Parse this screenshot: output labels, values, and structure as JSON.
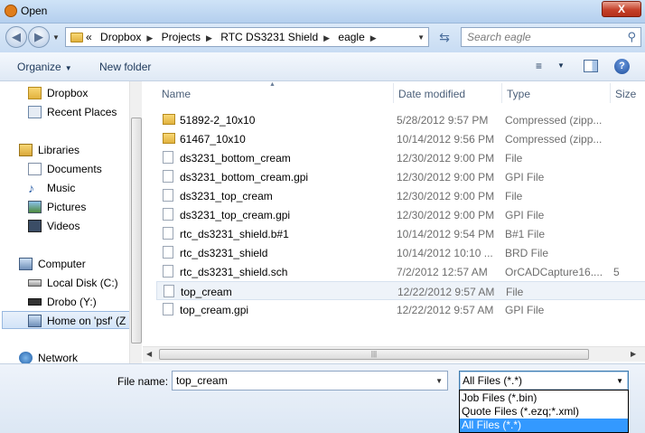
{
  "window": {
    "title": "Open",
    "close_label": "X"
  },
  "address": {
    "crumbs": [
      "«",
      "Dropbox",
      "Projects",
      "RTC DS3231 Shield",
      "eagle"
    ],
    "search_placeholder": "Search eagle"
  },
  "toolbar": {
    "organize": "Organize",
    "new_folder": "New folder"
  },
  "nav": {
    "items": [
      {
        "label": "Dropbox",
        "icon": "folder-icon"
      },
      {
        "label": "Recent Places",
        "icon": "recent-places-icon"
      },
      {
        "label": "Libraries",
        "icon": "libraries-icon"
      },
      {
        "label": "Documents",
        "icon": "documents-icon"
      },
      {
        "label": "Music",
        "icon": "music-icon"
      },
      {
        "label": "Pictures",
        "icon": "pictures-icon"
      },
      {
        "label": "Videos",
        "icon": "videos-icon"
      },
      {
        "label": "Computer",
        "icon": "computer-icon"
      },
      {
        "label": "Local Disk (C:)",
        "icon": "disk-icon"
      },
      {
        "label": "Drobo (Y:)",
        "icon": "drive-icon"
      },
      {
        "label": "Home on 'psf' (Z",
        "icon": "network-drive-icon"
      },
      {
        "label": "Network",
        "icon": "network-icon"
      }
    ]
  },
  "columns": {
    "name": "Name",
    "date": "Date modified",
    "type": "Type",
    "size": "Size"
  },
  "files": [
    {
      "name": "51892-2_10x10",
      "date": "5/28/2012 9:57 PM",
      "type": "Compressed (zipp...",
      "size": "",
      "icon": "zip-folder-icon"
    },
    {
      "name": "61467_10x10",
      "date": "10/14/2012 9:56 PM",
      "type": "Compressed (zipp...",
      "size": "",
      "icon": "zip-folder-icon"
    },
    {
      "name": "ds3231_bottom_cream",
      "date": "12/30/2012 9:00 PM",
      "type": "File",
      "size": "",
      "icon": "file-icon"
    },
    {
      "name": "ds3231_bottom_cream.gpi",
      "date": "12/30/2012 9:00 PM",
      "type": "GPI File",
      "size": "",
      "icon": "file-icon"
    },
    {
      "name": "ds3231_top_cream",
      "date": "12/30/2012 9:00 PM",
      "type": "File",
      "size": "",
      "icon": "file-icon"
    },
    {
      "name": "ds3231_top_cream.gpi",
      "date": "12/30/2012 9:00 PM",
      "type": "GPI File",
      "size": "",
      "icon": "file-icon"
    },
    {
      "name": "rtc_ds3231_shield.b#1",
      "date": "10/14/2012 9:54 PM",
      "type": "B#1 File",
      "size": "",
      "icon": "file-icon"
    },
    {
      "name": "rtc_ds3231_shield",
      "date": "10/14/2012 10:10 ...",
      "type": "BRD File",
      "size": "",
      "icon": "file-icon"
    },
    {
      "name": "rtc_ds3231_shield.sch",
      "date": "7/2/2012 12:57 AM",
      "type": "OrCADCapture16....",
      "size": "5",
      "icon": "file-icon"
    },
    {
      "name": "top_cream",
      "date": "12/22/2012 9:57 AM",
      "type": "File",
      "size": "",
      "icon": "file-icon"
    },
    {
      "name": "top_cream.gpi",
      "date": "12/22/2012 9:57 AM",
      "type": "GPI File",
      "size": "",
      "icon": "file-icon"
    }
  ],
  "bottom": {
    "file_name_label": "File name:",
    "file_name_value": "top_cream",
    "file_type_value": "All Files (*.*)",
    "type_options": [
      "Job Files (*.bin)",
      "Quote Files (*.ezq;*.xml)",
      "All Files (*.*)"
    ]
  }
}
